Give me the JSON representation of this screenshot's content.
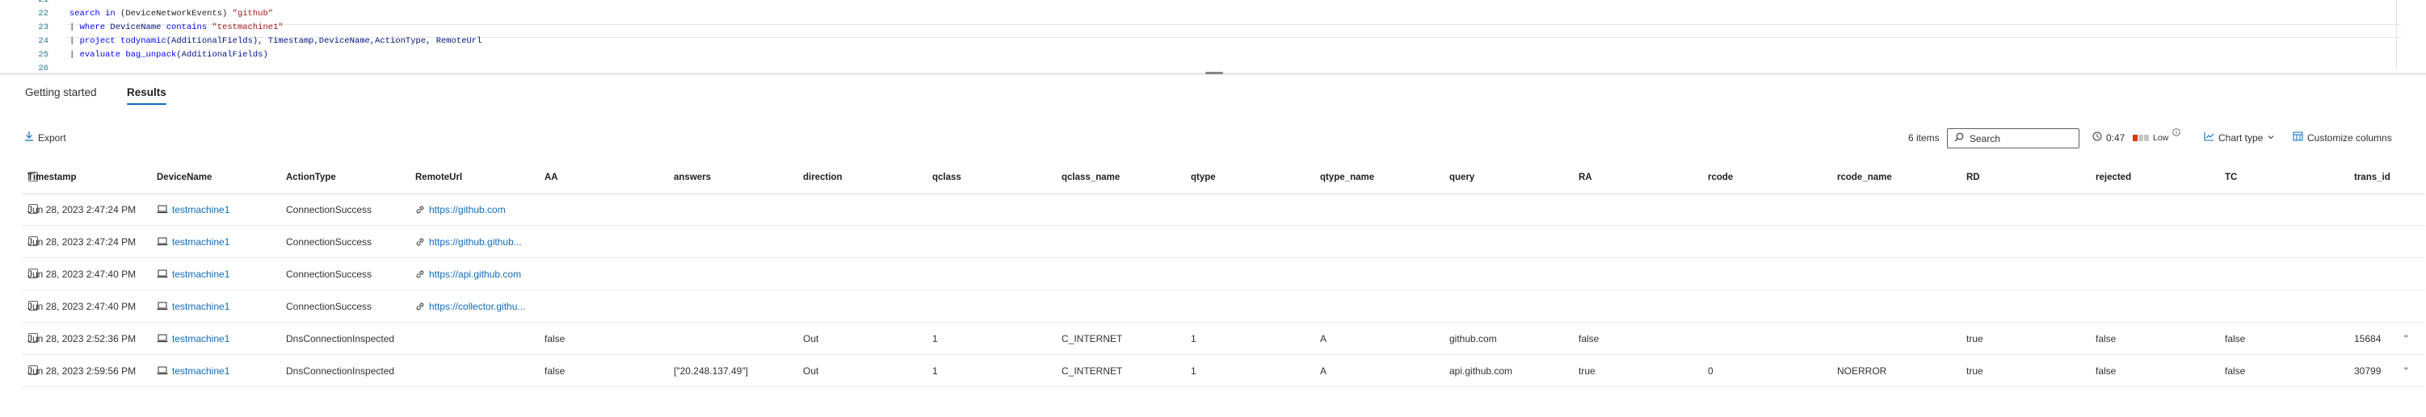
{
  "editor": {
    "lines": [
      {
        "no": "21",
        "tokens": []
      },
      {
        "no": "22",
        "tokens": [
          {
            "t": "search ",
            "c": "kw"
          },
          {
            "t": "in ",
            "c": "kw"
          },
          {
            "t": "(DeviceNetworkEvents) ",
            "c": ""
          },
          {
            "t": "\"github\"",
            "c": "str"
          }
        ]
      },
      {
        "no": "23",
        "tokens": [
          {
            "t": "| ",
            "c": ""
          },
          {
            "t": "where ",
            "c": "kw"
          },
          {
            "t": "DeviceName ",
            "c": "id"
          },
          {
            "t": "contains ",
            "c": "kw"
          },
          {
            "t": "\"testmachine1\"",
            "c": "str"
          }
        ]
      },
      {
        "no": "24",
        "tokens": [
          {
            "t": "| ",
            "c": ""
          },
          {
            "t": "project ",
            "c": "kw"
          },
          {
            "t": "todynamic",
            "c": "kw"
          },
          {
            "t": "(AdditionalFields), Timestamp,DeviceName,ActionType, RemoteUrl",
            "c": "id"
          }
        ]
      },
      {
        "no": "25",
        "tokens": [
          {
            "t": "| ",
            "c": ""
          },
          {
            "t": "evaluate ",
            "c": "kw"
          },
          {
            "t": "bag_unpack",
            "c": "kw"
          },
          {
            "t": "(AdditionalFields)",
            "c": "id"
          }
        ]
      },
      {
        "no": "26",
        "tokens": []
      }
    ]
  },
  "tabs": [
    {
      "label": "Getting started",
      "active": false
    },
    {
      "label": "Results",
      "active": true
    }
  ],
  "toolbar": {
    "export_label": "Export",
    "items_count": "6 items",
    "search_placeholder": "Search",
    "duration": "0:47",
    "resource_level": "Low",
    "chart_type_label": "Chart type",
    "customize_columns_label": "Customize columns"
  },
  "columns": [
    "Timestamp",
    "DeviceName",
    "ActionType",
    "RemoteUrl",
    "AA",
    "answers",
    "direction",
    "qclass",
    "qclass_name",
    "qtype",
    "qtype_name",
    "query",
    "RA",
    "rcode",
    "rcode_name",
    "RD",
    "rejected",
    "TC",
    "trans_id"
  ],
  "rows": [
    [
      "Jun 28, 2023 2:47:24 PM",
      "testmachine1",
      "ConnectionSuccess",
      "https://github.com",
      "",
      "",
      "",
      "",
      "",
      "",
      "",
      "",
      "",
      "",
      "",
      "",
      "",
      "",
      ""
    ],
    [
      "Jun 28, 2023 2:47:24 PM",
      "testmachine1",
      "ConnectionSuccess",
      "https://github.github...",
      "",
      "",
      "",
      "",
      "",
      "",
      "",
      "",
      "",
      "",
      "",
      "",
      "",
      "",
      ""
    ],
    [
      "Jun 28, 2023 2:47:40 PM",
      "testmachine1",
      "ConnectionSuccess",
      "https://api.github.com",
      "",
      "",
      "",
      "",
      "",
      "",
      "",
      "",
      "",
      "",
      "",
      "",
      "",
      "",
      ""
    ],
    [
      "Jun 28, 2023 2:47:40 PM",
      "testmachine1",
      "ConnectionSuccess",
      "https://collector.githu...",
      "",
      "",
      "",
      "",
      "",
      "",
      "",
      "",
      "",
      "",
      "",
      "",
      "",
      "",
      ""
    ],
    [
      "Jun 28, 2023 2:52:36 PM",
      "testmachine1",
      "DnsConnectionInspected",
      "",
      "false",
      "",
      "Out",
      "1",
      "C_INTERNET",
      "1",
      "A",
      "github.com",
      "false",
      "",
      "",
      "true",
      "false",
      "false",
      "15684"
    ],
    [
      "Jun 28, 2023 2:59:56 PM",
      "testmachine1",
      "DnsConnectionInspected",
      "",
      "false",
      "[\"20.248.137.49\"]",
      "Out",
      "1",
      "C_INTERNET",
      "1",
      "A",
      "api.github.com",
      "true",
      "0",
      "NOERROR",
      "true",
      "false",
      "false",
      "30799"
    ]
  ],
  "trailing_marks": [
    "",
    "",
    "",
    "",
    "\"",
    "\""
  ],
  "colors": {
    "accent": "#0f6cbd",
    "low_bar_1": "#d83b01",
    "low_bar_2": "#c8c6c4"
  }
}
